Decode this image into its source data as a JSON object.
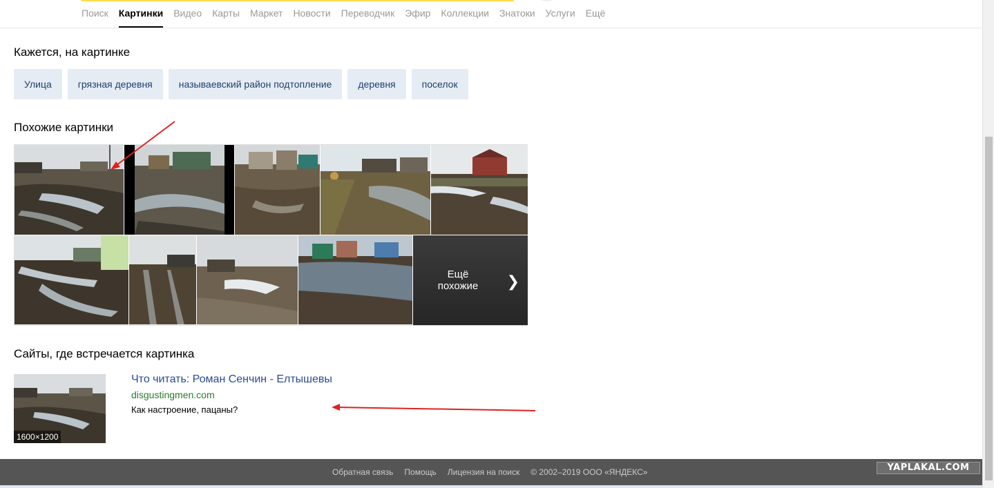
{
  "nav": {
    "items": [
      "Поиск",
      "Картинки",
      "Видео",
      "Карты",
      "Маркет",
      "Новости",
      "Переводчик",
      "Эфир",
      "Коллекции",
      "Знатоки",
      "Услуги",
      "Ещё"
    ],
    "active_index": 1
  },
  "tags_section": {
    "heading": "Кажется, на картинке",
    "tags": [
      "Улица",
      "грязная деревня",
      "называевский район подтопление",
      "деревня",
      "поселок"
    ]
  },
  "similar_section": {
    "heading": "Похожие картинки",
    "more_label_line1": "Ещё",
    "more_label_line2": "похожие"
  },
  "sites_section": {
    "heading": "Сайты, где встречается картинка",
    "result": {
      "title": "Что читать: Роман Сенчин - Елтышевы",
      "domain": "disgustingmen.com",
      "description": "Как настроение, пацаны?",
      "image_size": "1600×1200"
    }
  },
  "footer": {
    "links": [
      "Обратная связь",
      "Помощь",
      "Лицензия на поиск",
      "© 2002–2019  ООО «ЯНДЕКС»"
    ]
  },
  "watermark": "YAPLAKAL.COM",
  "colors": {
    "tag_bg": "#e6ecf4",
    "tag_text": "#1e3e6e",
    "link": "#2a4a8e",
    "domain": "#2a7a2a",
    "footer_bg": "#555555",
    "annotation_arrow": "#e02020",
    "nav_accent": "#ffdb4d"
  }
}
